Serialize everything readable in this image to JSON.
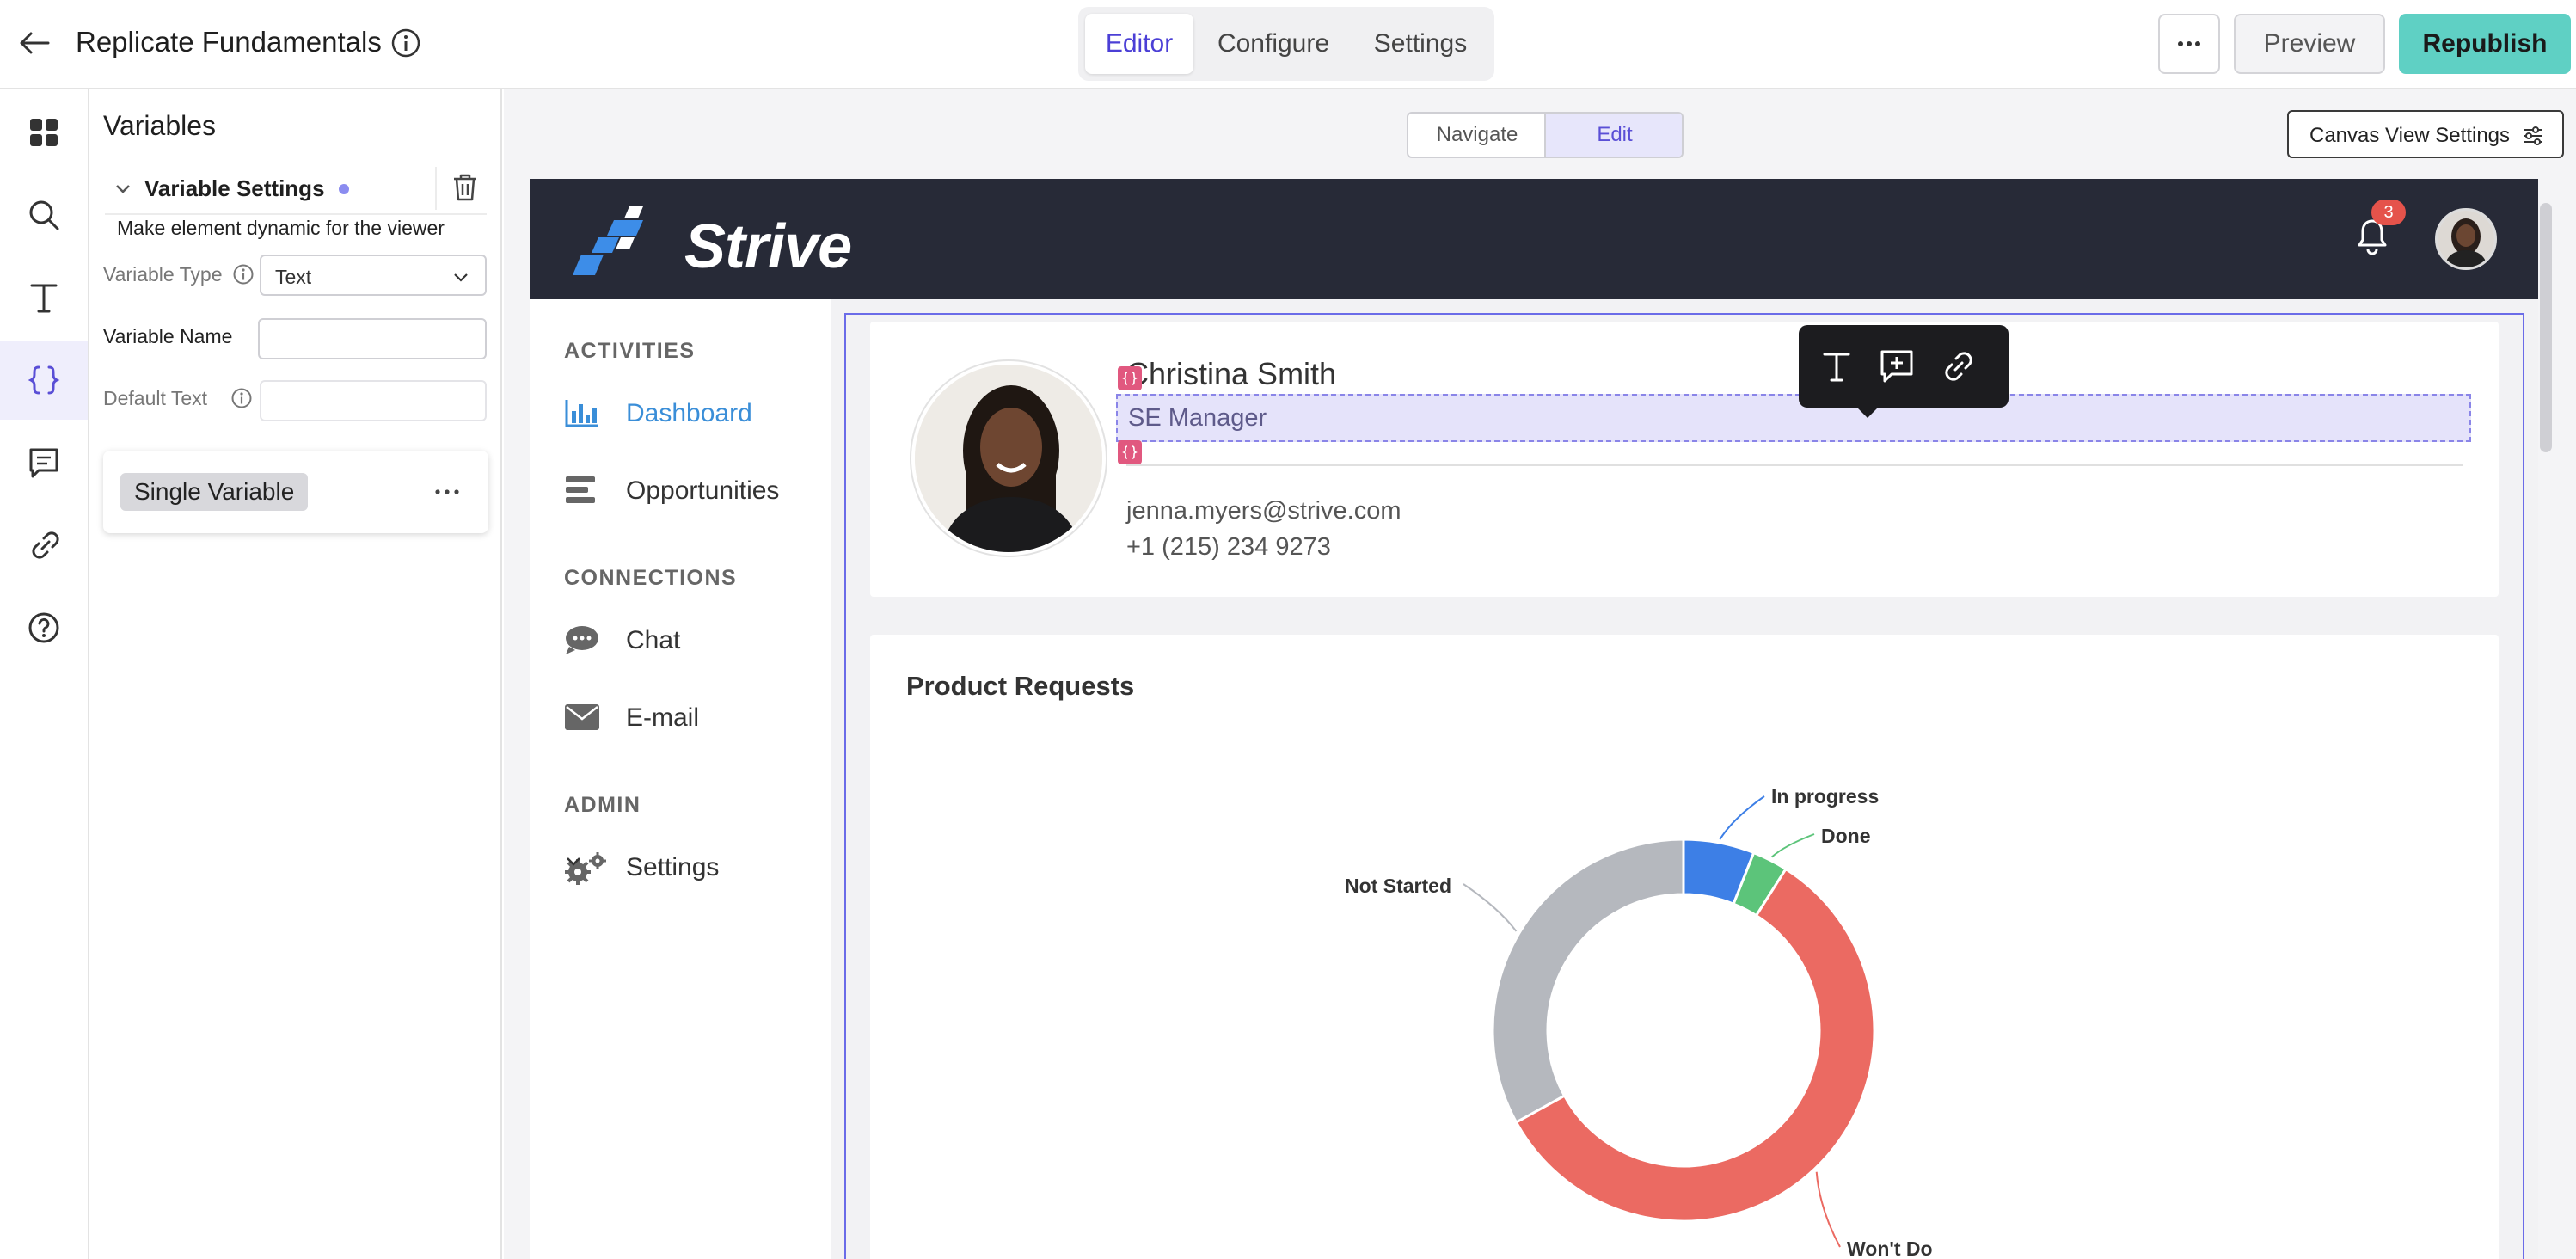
{
  "app": {
    "title": "Replicate Fundamentals",
    "tabs": [
      {
        "label": "Editor",
        "active": true
      },
      {
        "label": "Configure",
        "active": false
      },
      {
        "label": "Settings",
        "active": false
      }
    ],
    "preview_label": "Preview",
    "republish_label": "Republish"
  },
  "rail": {
    "items": [
      {
        "name": "dashboard",
        "icon": "grid-icon"
      },
      {
        "name": "search",
        "icon": "search-icon"
      },
      {
        "name": "text",
        "icon": "text-icon"
      },
      {
        "name": "variables",
        "icon": "braces-icon",
        "active": true
      },
      {
        "name": "comments",
        "icon": "comment-icon"
      },
      {
        "name": "links",
        "icon": "link-icon"
      },
      {
        "name": "help",
        "icon": "help-icon"
      }
    ]
  },
  "panel": {
    "title": "Variables",
    "section_label": "Variable Settings",
    "description": "Make element dynamic for the viewer",
    "variable_type_label": "Variable Type",
    "variable_type_value": "Text",
    "variable_name_label": "Variable Name",
    "variable_name_value": "",
    "default_text_label": "Default Text",
    "default_text_value": "",
    "variable_chip": "Single Variable"
  },
  "canvas": {
    "navigate_label": "Navigate",
    "edit_label": "Edit",
    "view_settings_label": "Canvas View Settings"
  },
  "strive": {
    "brand": "Strive",
    "notifications_count": "3",
    "nav": {
      "sections": [
        {
          "label": "ACTIVITIES",
          "items": [
            {
              "label": "Dashboard",
              "icon": "bar-chart-icon",
              "active": true
            },
            {
              "label": "Opportunities",
              "icon": "list-icon"
            }
          ]
        },
        {
          "label": "CONNECTIONS",
          "items": [
            {
              "label": "Chat",
              "icon": "chat-bubble-icon"
            },
            {
              "label": "E-mail",
              "icon": "envelope-icon"
            }
          ]
        },
        {
          "label": "ADMIN",
          "items": [
            {
              "label": "Settings",
              "icon": "gears-icon"
            }
          ]
        }
      ]
    },
    "profile": {
      "name": "Christina Smith",
      "role": "SE Manager",
      "email": "jenna.myers@strive.com",
      "phone": "+1 (215) 234 9273"
    },
    "chart_title": "Product Requests"
  },
  "colors": {
    "accent": "#5a4fd6",
    "republish": "#5fd0c4",
    "header": "#272a37",
    "link_blue": "#3a8ed8"
  },
  "chart_data": {
    "type": "pie",
    "title": "Product Requests",
    "donut": true,
    "categories": [
      "In progress",
      "Done",
      "Won't Do",
      "Not Started"
    ],
    "values": [
      6,
      3,
      58,
      33
    ],
    "colors": [
      "#3d7fe6",
      "#5cc47a",
      "#eb6a62",
      "#b5b8be"
    ]
  }
}
